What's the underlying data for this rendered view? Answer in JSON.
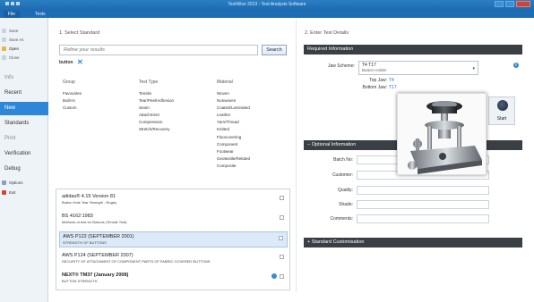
{
  "window": {
    "title": "TestWise 2013 - Test Analysis Software"
  },
  "ribbon": {
    "tabs": [
      "File",
      "Tests"
    ]
  },
  "sidebar": {
    "small_items": [
      "Save",
      "Save As",
      "Open",
      "Close"
    ],
    "items": [
      "Info",
      "Recent",
      "New",
      "Standards",
      "Print",
      "Verification",
      "Debug"
    ],
    "bottom_items": [
      "Options",
      "Exit"
    ]
  },
  "left": {
    "section_title": "1. Select Standard",
    "search": {
      "placeholder": "Refine your results",
      "button": "Search"
    },
    "filter_tag": "button",
    "facets": {
      "group": {
        "header": "Group",
        "items": [
          "Favourites",
          "Built-In",
          "Custom"
        ]
      },
      "test_type": {
        "header": "Test Type",
        "items": [
          "Tensile",
          "Tear/Peel/Adhesion",
          "Seam",
          "Attachment",
          "Compression",
          "Stretch/Recovery"
        ]
      },
      "material": {
        "header": "Material",
        "items": [
          "Woven",
          "Nonwoven",
          "Coated/Laminated",
          "Leather",
          "Yarn/Thread",
          "Knitted",
          "Floorcovering",
          "Component",
          "Footwear",
          "Geotextile/Related",
          "Composite"
        ]
      }
    },
    "results": [
      {
        "title": "adidas® 4.15 Version 81",
        "subtitle": "Button Hole Tear Strength - Rugby",
        "selected": false
      },
      {
        "title": "BS 4162:1983",
        "subtitle": "Methods of test for Buttons (Tensile Test)",
        "selected": false
      },
      {
        "title": "AWS P122 (SEPTEMBER 2001)",
        "subtitle": "STRENGTH OF BUTTONS",
        "selected": true
      },
      {
        "title": "AWS P124 (SEPTEMBER 2007)",
        "subtitle": "SECURITY OF ATTACHMENT OF COMPONENT PARTS OF FABRIC COVERED BUTTONS",
        "selected": false
      },
      {
        "title": "NEXT® TM37 (January 2008)",
        "subtitle": "BUTTON STRENGTH",
        "selected": false
      }
    ]
  },
  "right": {
    "section_title": "2. Enter Test Details",
    "required_bar": "Required Information",
    "jaw_label": "Jaw Scheme:",
    "jaw_value": "T4 T17",
    "jaw_sub": "Button Holder",
    "top_jaw_label": "Top Jaw:",
    "top_jaw_value": "T4",
    "bottom_jaw_label": "Bottom Jaw:",
    "bottom_jaw_value": "T17",
    "start_label": "Start",
    "optional_bar": "− Optional Information",
    "fields": [
      "Batch No:",
      "Customer:",
      "Quality:",
      "Shade:",
      "Comments:"
    ],
    "customisation_bar": "+ Standard Customisation"
  },
  "colors": {
    "accent": "#2e86d6",
    "title_bar": "#1e6bb0",
    "section_bar": "#3a3f45"
  }
}
